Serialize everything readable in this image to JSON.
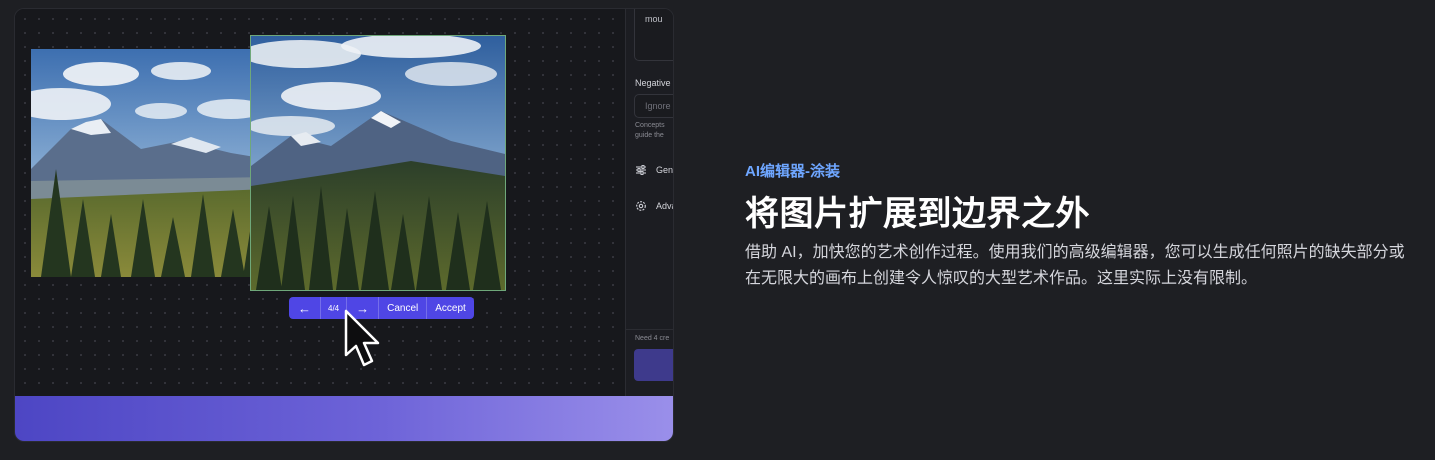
{
  "editor": {
    "controls": {
      "prev_icon": "arrow-left-icon",
      "counter": "4/4",
      "next_icon": "arrow-right-icon",
      "cancel_label": "Cancel",
      "accept_label": "Accept"
    },
    "panel": {
      "prompt_value": "mou",
      "negative_label": "Negative",
      "negative_placeholder": "Ignore",
      "help_line_1": "Concepts",
      "help_line_2": "guide the",
      "general_label": "Gene",
      "general_icon": "sliders-icon",
      "advanced_label": "Adva",
      "advanced_icon": "gear-icon",
      "credits_text": "Need 4 cre"
    }
  },
  "feature": {
    "eyebrow": "AI编辑器-涂装",
    "title": "将图片扩展到边界之外",
    "description": "借助 AI，加快您的艺术创作过程。使用我们的高级编辑器，您可以生成任何照片的缺失部分或在无限大的画布上创建令人惊叹的大型艺术作品。这里实际上没有限制。"
  },
  "colors": {
    "accent": "#4f46e5",
    "eyebrow": "#6ea6ff",
    "background": "#1e1f23"
  }
}
